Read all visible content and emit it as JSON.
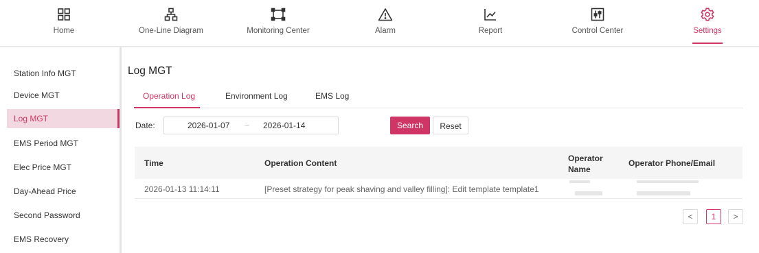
{
  "nav": {
    "items": [
      {
        "label": "Home",
        "icon": "grid-icon"
      },
      {
        "label": "One-Line Diagram",
        "icon": "hierarchy-icon"
      },
      {
        "label": "Monitoring Center",
        "icon": "monitor-frame-icon"
      },
      {
        "label": "Alarm",
        "icon": "warning-icon"
      },
      {
        "label": "Report",
        "icon": "line-chart-icon"
      },
      {
        "label": "Control Center",
        "icon": "sliders-icon"
      },
      {
        "label": "Settings",
        "icon": "gear-icon"
      }
    ],
    "active": "Settings"
  },
  "sidebar": {
    "items": [
      {
        "label": "Station Info MGT"
      },
      {
        "label": "Device MGT"
      },
      {
        "label": "Log MGT"
      },
      {
        "label": "EMS Period MGT"
      },
      {
        "label": "Elec Price MGT"
      },
      {
        "label": "Day-Ahead Price"
      },
      {
        "label": "Second Password"
      },
      {
        "label": "EMS Recovery"
      }
    ],
    "active": "Log MGT"
  },
  "main": {
    "title": "Log MGT",
    "tabs": [
      {
        "label": "Operation Log"
      },
      {
        "label": "Environment Log"
      },
      {
        "label": "EMS Log"
      }
    ],
    "active_tab": "Operation Log"
  },
  "filter": {
    "date_label": "Date:",
    "start_date": "2026-01-07",
    "separator": "~",
    "end_date": "2026-01-14",
    "search_label": "Search",
    "reset_label": "Reset"
  },
  "table": {
    "headers": [
      "Time",
      "Operation Content",
      "Operator Name",
      "Operator Phone/Email"
    ],
    "rows": [
      {
        "time": "2026-01-13 11:14:11",
        "content": "[Preset strategy for peak shaving and valley filling]:  Edit template template1"
      }
    ]
  },
  "pagination": {
    "prev": "<",
    "current": "1",
    "next": ">"
  },
  "colors": {
    "accent": "#cf3666",
    "active_bg": "#f2d8e1"
  }
}
